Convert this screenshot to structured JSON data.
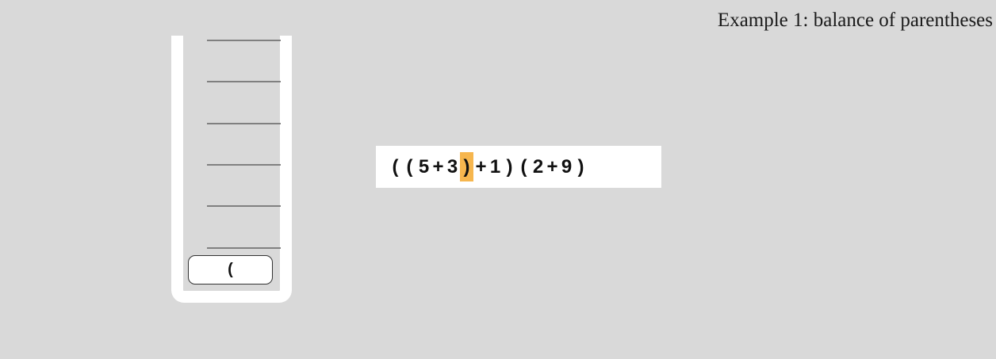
{
  "title": "Example 1: balance of  parentheses",
  "stack": {
    "slots": 6,
    "items": [
      "("
    ]
  },
  "expression": {
    "tokens": [
      "(",
      "(",
      "5",
      "+",
      "3",
      ")",
      "+",
      "1",
      ")",
      "(",
      "2",
      "+",
      "9",
      ")"
    ],
    "highlight_index": 5,
    "highlight_color": "#f6b64e"
  }
}
